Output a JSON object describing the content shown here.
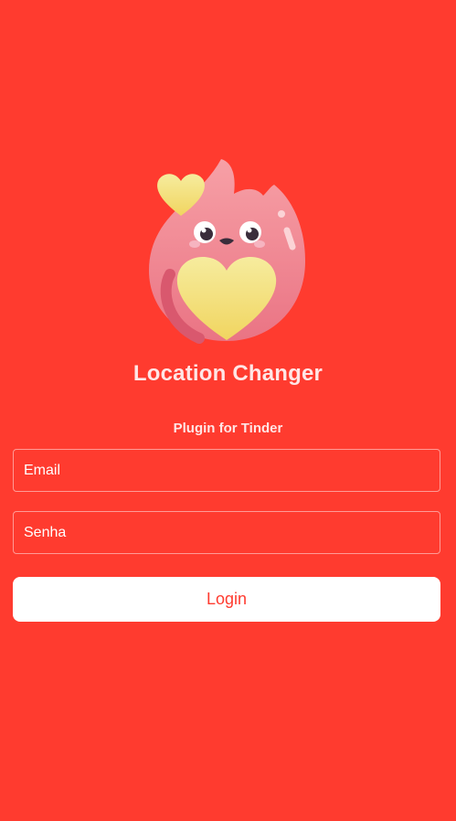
{
  "brand": {
    "background_color": "#ff3b2f",
    "mascot_icon": "flame-heart-mascot-icon"
  },
  "header": {
    "title": "Location Changer",
    "subtitle": "Plugin for Tinder"
  },
  "form": {
    "email_placeholder": "Email",
    "password_placeholder": "Senha",
    "login_label": "Login"
  }
}
